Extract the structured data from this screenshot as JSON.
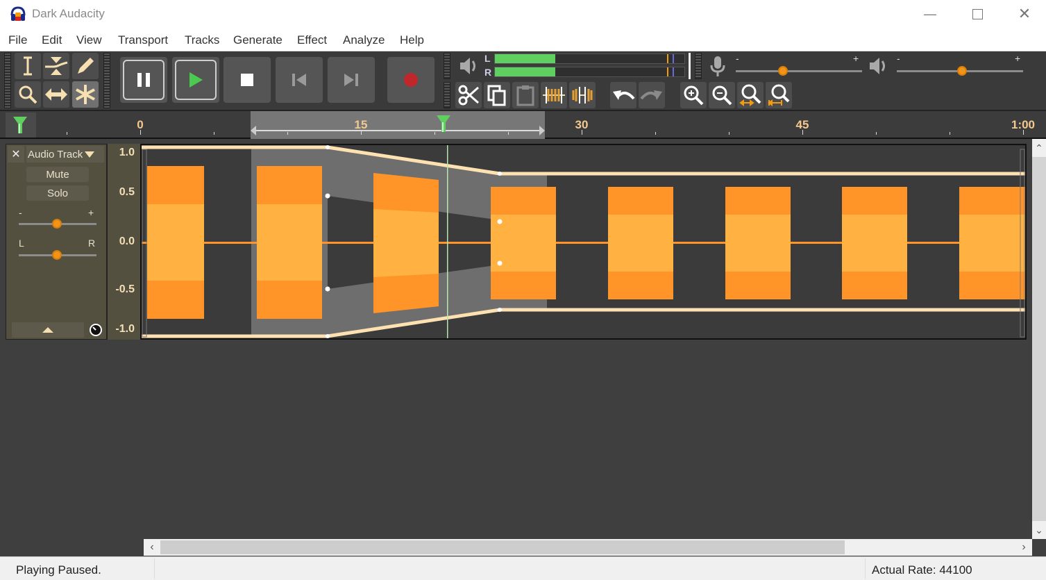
{
  "window": {
    "title": "Dark Audacity",
    "controls": [
      "minimize",
      "maximize",
      "close"
    ]
  },
  "menu": {
    "items": [
      "File",
      "Edit",
      "View",
      "Transport",
      "Tracks",
      "Generate",
      "Effect",
      "Analyze",
      "Help"
    ]
  },
  "tools": {
    "items": [
      {
        "name": "selection-tool",
        "icon": "I-beam"
      },
      {
        "name": "envelope-tool",
        "icon": "envelope"
      },
      {
        "name": "draw-tool",
        "icon": "pencil"
      },
      {
        "name": "zoom-tool",
        "icon": "magnifier"
      },
      {
        "name": "time-shift-tool",
        "icon": "double-arrow"
      },
      {
        "name": "multi-tool",
        "icon": "asterisk",
        "active": true
      }
    ]
  },
  "transport": {
    "buttons": [
      "pause",
      "play",
      "stop",
      "skip-to-start",
      "skip-to-end",
      "record"
    ],
    "colors": {
      "play": "#4cc94f",
      "record": "#c0272d"
    }
  },
  "meter": {
    "left_label": "L",
    "right_label": "R",
    "left_level_pct": 32,
    "right_level_pct": 32,
    "colors": {
      "fill": "#5fcf60",
      "peak": "#f39c12",
      "max": "#6a6adc"
    }
  },
  "mixer": {
    "record_minus": "-",
    "record_plus": "+",
    "record_volume_pct": 38,
    "playback_minus": "-",
    "playback_plus": "+",
    "playback_volume_pct": 52
  },
  "edit_toolbar": {
    "buttons": [
      "cut",
      "copy",
      "paste",
      "trim",
      "silence",
      "undo",
      "redo",
      "zoom-in",
      "zoom-out",
      "fit-selection",
      "fit-project"
    ]
  },
  "ruler": {
    "labels": [
      {
        "text": "0",
        "time": 0
      },
      {
        "text": "15",
        "time": 15
      },
      {
        "text": "30",
        "time": 30
      },
      {
        "text": "45",
        "time": 45
      },
      {
        "text": "1:00",
        "time": 60
      }
    ],
    "selection_start": 7.5,
    "selection_end": 27.5,
    "playhead": 20.6
  },
  "track": {
    "name": "Audio Track",
    "mute_label": "Mute",
    "solo_label": "Solo",
    "gain_minus": "-",
    "gain_plus": "+",
    "pan_left": "L",
    "pan_right": "R",
    "gain_pct": 50,
    "pan_pct": 50,
    "scale_labels": [
      "1.0",
      "0.5",
      "0.0",
      "-0.5",
      "-1.0"
    ],
    "waveform_color": "#ff9528",
    "rms_color": "#ffb142",
    "envelope_color": "#fde1b0"
  },
  "status": {
    "left": "Playing Paused.",
    "right": "Actual Rate: 44100"
  }
}
